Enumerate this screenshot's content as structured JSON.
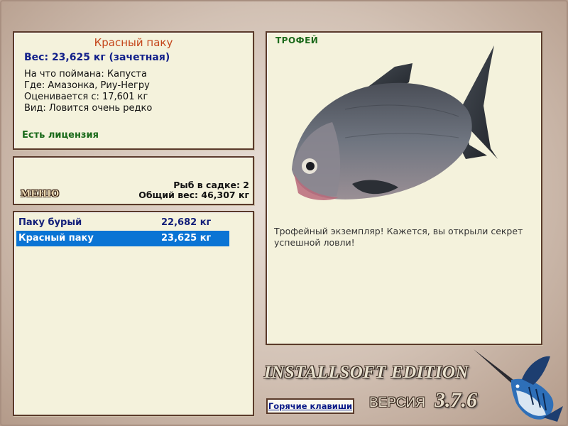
{
  "info": {
    "fish_name": "Красный паку",
    "weight": "Вес: 23,625 кг (зачетная)",
    "caught_on": "На что поймана: Капуста",
    "location": "Где: Амазонка, Риу-Негру",
    "rated_from": "Оценивается с: 17,601 кг",
    "species": "Вид: Ловится очень редко",
    "license": "Есть лицензия"
  },
  "keepnet": {
    "menu_label": "МЕНЮ",
    "fish_count": "Рыб в садке: 2",
    "total_weight": "Общий вес: 46,307 кг"
  },
  "catch_list": [
    {
      "name": "Паку бурый",
      "weight": "22,682 кг",
      "selected": false
    },
    {
      "name": "Красный паку",
      "weight": "23,625 кг",
      "selected": true
    }
  ],
  "trophy": {
    "title": "ТРОФЕЙ",
    "description": "Трофейный экземпляр! Кажется, вы открыли секрет успешной ловли!",
    "image_icon": "red-pacu-fish-image"
  },
  "branding": {
    "edition": "INSTALLSOFT EDITION",
    "version_label": "ВЕРСИЯ",
    "version_number": "3.7.6",
    "hotkeys_label": "Горячие клавиши",
    "logo_icon": "marlin-logo"
  },
  "colors": {
    "panel_bg": "#f4f2dc",
    "panel_border": "#5a3a2a",
    "fish_name": "#c4441a",
    "weight": "#12208a",
    "license": "#1a6a1a",
    "selection": "#0a74d4"
  }
}
